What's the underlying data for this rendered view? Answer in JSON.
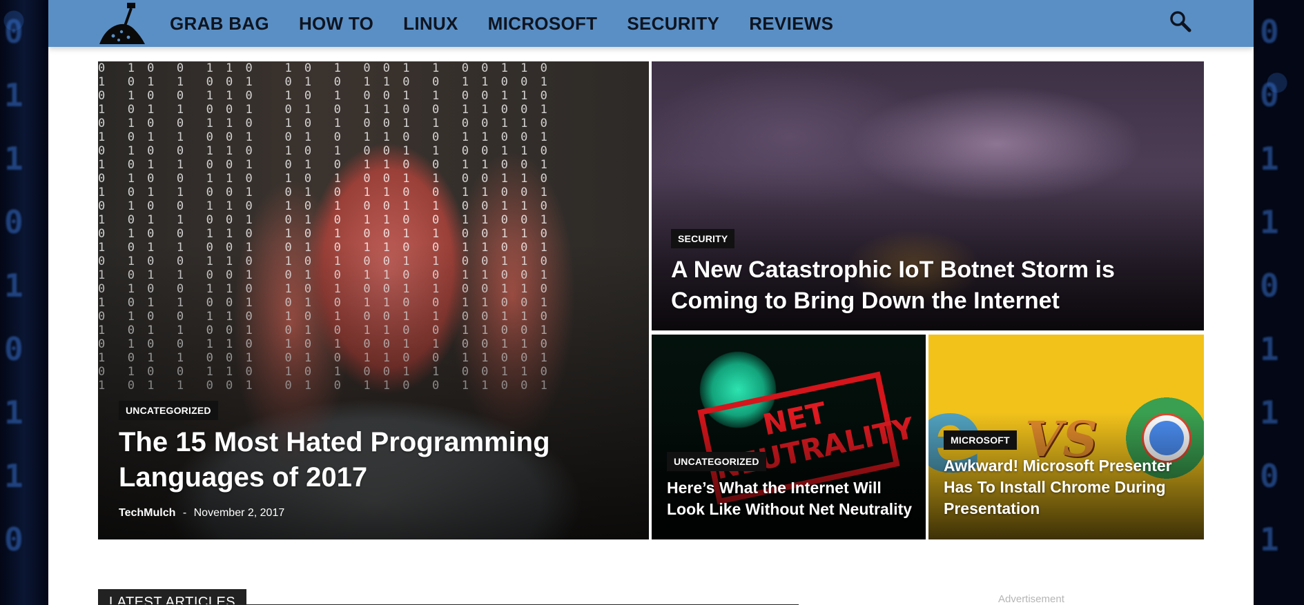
{
  "nav": {
    "logo_name": "digging-shovel-logo",
    "items": [
      "GRAB BAG",
      "HOW TO",
      "LINUX",
      "MICROSOFT",
      "SECURITY",
      "REVIEWS"
    ],
    "search_icon": "search-icon"
  },
  "featured": {
    "main": {
      "category": "UNCATEGORIZED",
      "title": "The 15 Most Hated Programming Languages of 2017",
      "author": "TechMulch",
      "separator": "-",
      "date": "November 2, 2017"
    },
    "storm": {
      "category": "SECURITY",
      "title": "A New Catastrophic IoT Botnet Storm is Coming to Bring Down the Internet"
    },
    "net": {
      "category": "UNCATEGORIZED",
      "title": "Here’s What the Internet Will Look Like Without Net Neutrality",
      "stamp_text": "NET NEUTRALITY"
    },
    "vs": {
      "category": "MICROSOFT",
      "title": "Awkward! Microsoft Presenter Has To Install Chrome During Presentation",
      "vs_text": "VS"
    }
  },
  "latest_label": "LATEST ARTICLES",
  "ad_label": "Advertisement",
  "colors": {
    "topbar": "#5a8fc5",
    "category_bg": "#111111"
  }
}
